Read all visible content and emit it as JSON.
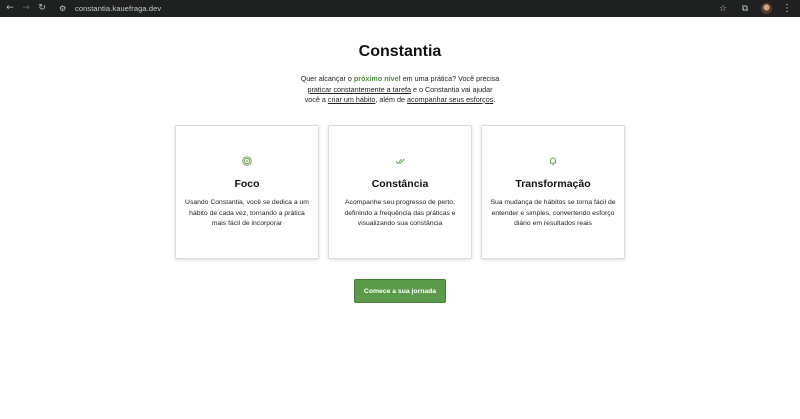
{
  "browser": {
    "url": "constantia.kauefraga.dev"
  },
  "hero": {
    "title": "Constantia",
    "intro": {
      "p1": "Quer alcançar o ",
      "highlight": "próximo nível",
      "p2": " em uma prática? Você precisa ",
      "u1": "praticar constantemente a tarefa",
      "p3": " e o Constantia vai ajudar você a ",
      "u2": "criar um hábito",
      "p4": ", além de ",
      "u3": "acompanhar seus esforços",
      "p5": "."
    }
  },
  "features": [
    {
      "icon": "target-icon",
      "title": "Foco",
      "description": "Usando Constantia, você se dedica a um hábito de cada vez, tornando a prática mais fácil de incorporar"
    },
    {
      "icon": "double-check-icon",
      "title": "Constância",
      "description": "Acompanhe seu progresso de perto, definindo a frequência das práticas e visualizando sua constância"
    },
    {
      "icon": "bell-icon",
      "title": "Transformação",
      "description": "Sua mudança de hábitos se torna fácil de entender e simples, convertendo esforço diário em resultados reais"
    }
  ],
  "cta": {
    "label": "Comece a sua jornada"
  },
  "colors": {
    "accent": "#5b9a49",
    "highlight": "#4f8e3c",
    "chrome": "#1f2020"
  }
}
